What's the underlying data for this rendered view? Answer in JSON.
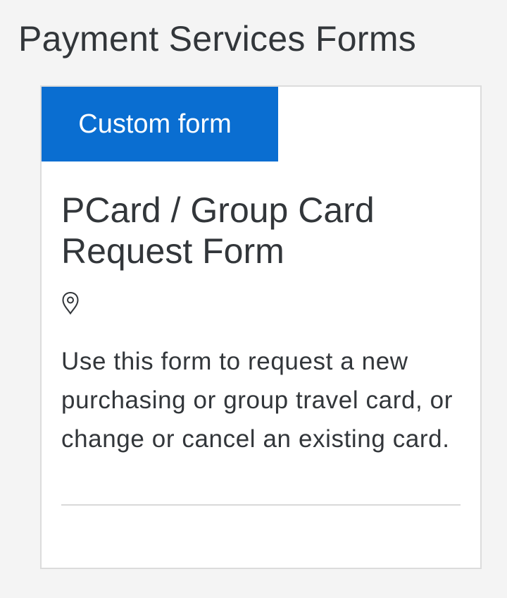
{
  "section": {
    "title": "Payment Services Forms"
  },
  "card": {
    "badge_label": "Custom form",
    "title": "PCard / Group Card Request Form",
    "location_icon": "map-pin-icon",
    "description": "Use this form to request a new purchasing or group travel card, or change or cancel an existing card."
  },
  "colors": {
    "accent": "#0a6ed1",
    "background": "#f4f4f4",
    "card_background": "#ffffff",
    "text": "#32363a"
  }
}
